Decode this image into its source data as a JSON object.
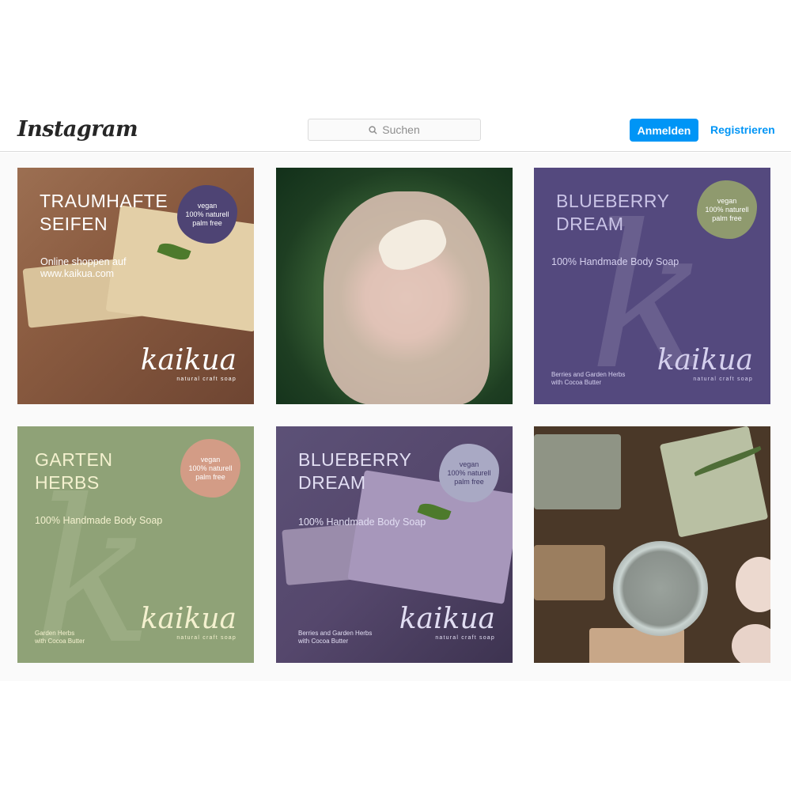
{
  "header": {
    "logo": "Instagram",
    "search_placeholder": "Suchen",
    "login_label": "Anmelden",
    "register_label": "Registrieren"
  },
  "posts": [
    {
      "title_line1": "TRAUMHAFTE",
      "title_line2": "SEIFEN",
      "subtitle_line1": "Online shoppen auf",
      "subtitle_line2": "www.kaikua.com",
      "badge": [
        "vegan",
        "100% naturell",
        "palm free"
      ],
      "brand": "kaikua",
      "brand_tag": "natural craft soap"
    },
    {},
    {
      "title_line1": "BLUEBERRY",
      "title_line2": "DREAM",
      "subtitle": "100% Handmade Body Soap",
      "badge": [
        "vegan",
        "100% naturell",
        "palm free"
      ],
      "small_line1": "Berries and Garden Herbs",
      "small_line2": "with Cocoa Butter",
      "brand": "kaikua",
      "brand_tag": "natural craft soap"
    },
    {
      "title_line1": "GARTEN",
      "title_line2": "HERBS",
      "subtitle": "100% Handmade Body Soap",
      "badge": [
        "vegan",
        "100% naturell",
        "palm free"
      ],
      "small_line1": "Garden Herbs",
      "small_line2": "with Cocoa Butter",
      "brand": "kaikua",
      "brand_tag": "natural craft soap"
    },
    {
      "title_line1": "BLUEBERRY",
      "title_line2": "DREAM",
      "subtitle": "100% Handmade Body Soap",
      "badge": [
        "vegan",
        "100% naturell",
        "palm free"
      ],
      "small_line1": "Berries and Garden Herbs",
      "small_line2": "with Cocoa Butter",
      "brand": "kaikua",
      "brand_tag": "natural craft soap"
    },
    {}
  ],
  "colors": {
    "accent": "#0095f6",
    "tile1_badge": "#4e4474",
    "tile3_bg": "#54497e",
    "tile3_badge": "#8f9a6e",
    "tile4_bg": "#8fa277",
    "tile4_badge": "#d39c86",
    "tile5_badge": "#a9a9c4"
  }
}
